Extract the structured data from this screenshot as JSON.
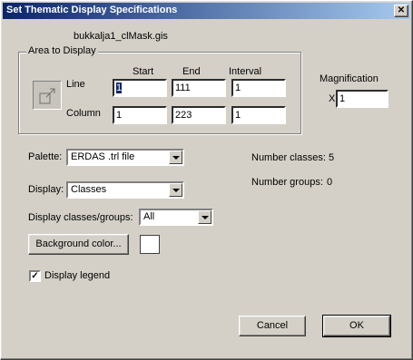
{
  "window": {
    "title": "Set Thematic Display Specifications",
    "close_glyph": "✕"
  },
  "filename": "bukkalja1_clMask.gis",
  "area": {
    "legend": "Area to Display",
    "headers": {
      "start": "Start",
      "end": "End",
      "interval": "Interval"
    },
    "line": {
      "label": "Line",
      "start": "1",
      "end": "111",
      "interval": "1"
    },
    "column": {
      "label": "Column",
      "start": "1",
      "end": "223",
      "interval": "1"
    }
  },
  "magnification": {
    "label": "Magnification",
    "prefix": "X",
    "value": "1"
  },
  "palette": {
    "label": "Palette:",
    "value": "ERDAS .trl file"
  },
  "display": {
    "label": "Display:",
    "value": "Classes"
  },
  "classes_groups": {
    "label": "Display classes/groups:",
    "value": "All"
  },
  "stats": {
    "classes_label": "Number classes:",
    "classes_value": "5",
    "groups_label": "Number groups:",
    "groups_value": "0"
  },
  "background_button": "Background color...",
  "legend_checkbox": {
    "label": "Display legend",
    "checked": true,
    "glyph": "✓"
  },
  "buttons": {
    "cancel": "Cancel",
    "ok": "OK"
  }
}
